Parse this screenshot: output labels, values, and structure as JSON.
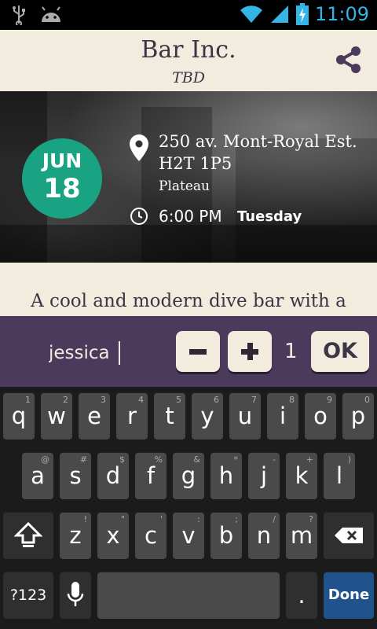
{
  "status_bar": {
    "time": "11:09",
    "icons": [
      "usb-icon",
      "android-icon",
      "wifi-icon",
      "signal-icon",
      "battery-charging-icon"
    ]
  },
  "event": {
    "title": "Bar Inc.",
    "subtitle": "TBD",
    "date_month": "JUN",
    "date_day": "18",
    "address_line1": "250 av. Mont-Royal Est.",
    "address_line2": "H2T 1P5",
    "neighborhood": "Plateau",
    "time": "6:00 PM",
    "weekday": "Tuesday",
    "description": "A cool and modern dive bar with a"
  },
  "rsvp_bar": {
    "name_value": "jessica",
    "count": "1",
    "ok_label": "OK"
  },
  "keyboard": {
    "row1": [
      {
        "label": "q",
        "hint": "1"
      },
      {
        "label": "w",
        "hint": "2"
      },
      {
        "label": "e",
        "hint": "3"
      },
      {
        "label": "r",
        "hint": "4"
      },
      {
        "label": "t",
        "hint": "5"
      },
      {
        "label": "y",
        "hint": "6"
      },
      {
        "label": "u",
        "hint": "7"
      },
      {
        "label": "i",
        "hint": "8"
      },
      {
        "label": "o",
        "hint": "9"
      },
      {
        "label": "p",
        "hint": "0"
      }
    ],
    "row2": [
      {
        "label": "a",
        "hint": "@"
      },
      {
        "label": "s",
        "hint": "#"
      },
      {
        "label": "d",
        "hint": "$"
      },
      {
        "label": "f",
        "hint": "%"
      },
      {
        "label": "g",
        "hint": "&"
      },
      {
        "label": "h",
        "hint": "*"
      },
      {
        "label": "j",
        "hint": "-"
      },
      {
        "label": "k",
        "hint": "+"
      },
      {
        "label": "l",
        "hint": ")"
      }
    ],
    "row3": [
      {
        "label": "z",
        "hint": "!"
      },
      {
        "label": "x",
        "hint": "\""
      },
      {
        "label": "c",
        "hint": "'"
      },
      {
        "label": "v",
        "hint": ":"
      },
      {
        "label": "b",
        "hint": ";"
      },
      {
        "label": "n",
        "hint": "/"
      },
      {
        "label": "m",
        "hint": "?"
      }
    ],
    "symbols_label": "?123",
    "period_label": ".",
    "done_label": "Done"
  }
}
